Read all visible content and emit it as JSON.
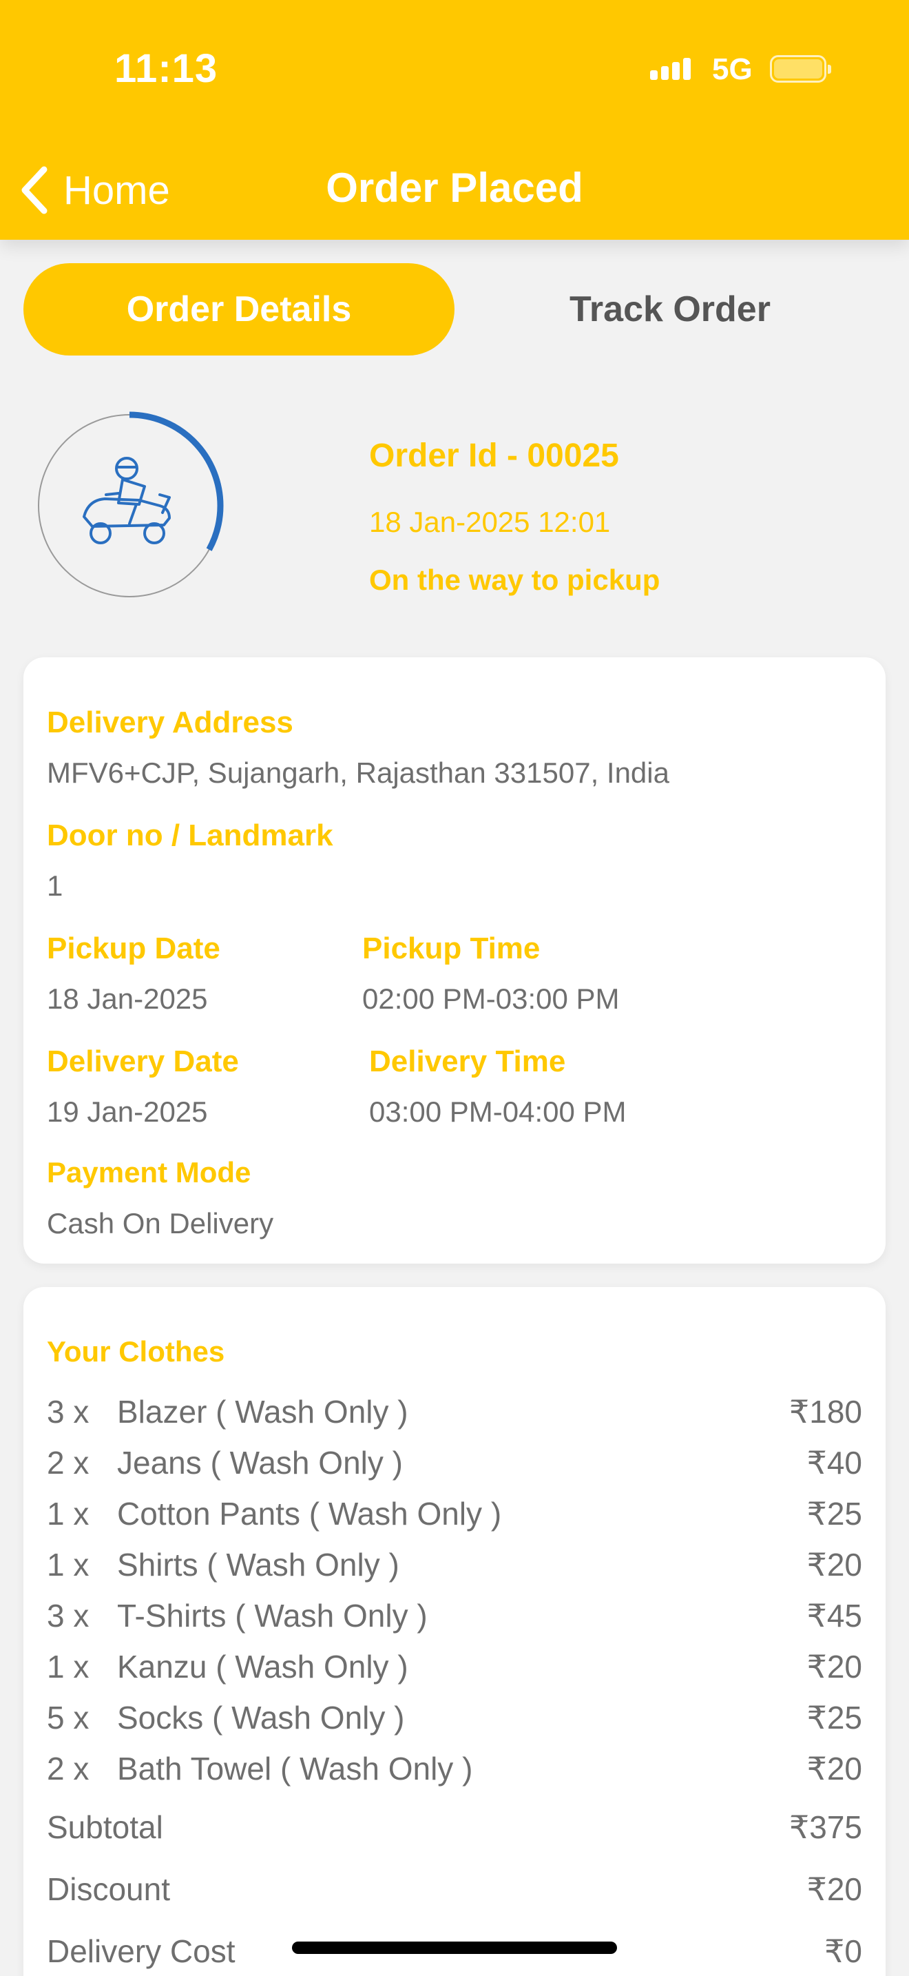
{
  "status_bar": {
    "time": "11:13",
    "network": "5G"
  },
  "nav": {
    "back_label": "Home",
    "title": "Order Placed"
  },
  "tabs": [
    {
      "label": "Order Details",
      "active": true
    },
    {
      "label": "Track Order",
      "active": false
    }
  ],
  "order": {
    "id_text": "Order Id - 00025",
    "date_text": "18 Jan-2025 12:01",
    "status_text": "On the way to pickup",
    "progress": 0.33
  },
  "details": {
    "delivery_address_label": "Delivery Address",
    "delivery_address": "MFV6+CJP, Sujangarh, Rajasthan 331507, India",
    "door_label": "Door no / Landmark",
    "door_value": "1",
    "pickup_date_label": "Pickup Date",
    "pickup_date": "18 Jan-2025",
    "pickup_time_label": "Pickup Time",
    "pickup_time": "02:00 PM-03:00 PM",
    "delivery_date_label": "Delivery Date",
    "delivery_date": "19 Jan-2025",
    "delivery_time_label": "Delivery Time",
    "delivery_time": "03:00 PM-04:00 PM",
    "payment_mode_label": "Payment Mode",
    "payment_mode": "Cash On Delivery"
  },
  "clothes": {
    "title": "Your Clothes",
    "items": [
      {
        "qty": "3 x",
        "name": "Blazer ( Wash Only )",
        "price": "₹180"
      },
      {
        "qty": "2 x",
        "name": "Jeans ( Wash Only )",
        "price": "₹40"
      },
      {
        "qty": "1 x",
        "name": "Cotton Pants ( Wash Only )",
        "price": "₹25"
      },
      {
        "qty": "1 x",
        "name": "Shirts ( Wash Only )",
        "price": "₹20"
      },
      {
        "qty": "3 x",
        "name": "T-Shirts ( Wash Only )",
        "price": "₹45"
      },
      {
        "qty": "1 x",
        "name": "Kanzu ( Wash Only )",
        "price": "₹20"
      },
      {
        "qty": "5 x",
        "name": "Socks ( Wash Only )",
        "price": "₹25"
      },
      {
        "qty": "2 x",
        "name": "Bath Towel ( Wash Only )",
        "price": "₹20"
      }
    ],
    "subtotal_label": "Subtotal",
    "subtotal": "₹375",
    "discount_label": "Discount",
    "discount": "₹20",
    "delivery_cost_label": "Delivery Cost",
    "delivery_cost": "₹0"
  },
  "icons": {
    "back": "chevron-left-icon",
    "rider": "scooter-rider-icon",
    "signal": "signal-bars-icon",
    "battery": "battery-icon"
  },
  "colors": {
    "accent": "#FFC800",
    "ring_progress": "#2a6fc0",
    "text_gray": "#6e6e6e"
  }
}
